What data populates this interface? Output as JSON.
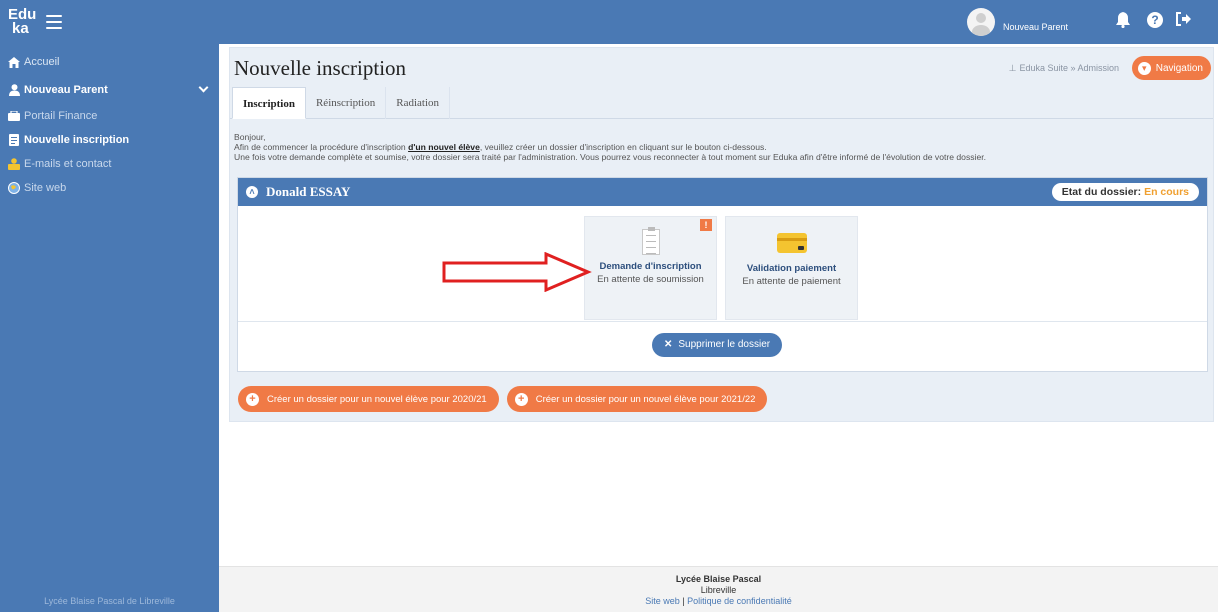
{
  "brand": {
    "logo_line1": "Edu",
    "logo_line2": "ka"
  },
  "sidebar": {
    "items": [
      {
        "label": "Accueil",
        "icon": "home-icon"
      },
      {
        "label": "Nouveau Parent",
        "icon": "user-icon"
      },
      {
        "label": "Portail Finance",
        "icon": "finance-icon"
      },
      {
        "label": "Nouvelle inscription",
        "icon": "document-icon"
      },
      {
        "label": "E-mails et contact",
        "icon": "mail-icon"
      },
      {
        "label": "Site web",
        "icon": "globe-icon"
      }
    ],
    "footer": "Lycée Blaise Pascal de Libreville"
  },
  "topbar": {
    "user_name": "Nouveau Parent",
    "icons": [
      "bell-icon",
      "help-icon",
      "logout-icon"
    ]
  },
  "page": {
    "title": "Nouvelle inscription",
    "breadcrumb": "Eduka Suite » Admission",
    "nav_button": "Navigation"
  },
  "tabs": [
    "Inscription",
    "Réinscription",
    "Radiation"
  ],
  "intro": {
    "line1": "Bonjour,",
    "line2_a": "Afin de commencer la procédure d'inscription ",
    "line2_em": "d'un nouvel élève",
    "line2_b": ", veuillez créer un dossier d'inscription en cliquant sur le bouton ci-dessous.",
    "line3": "Une fois votre demande complète et soumise, votre dossier sera traité par l'administration. Vous pourrez vous reconnecter à tout moment sur Eduka afin d'être informé de l'évolution de votre dossier."
  },
  "dossier": {
    "name": "Donald ESSAY",
    "state_label": "Etat du dossier:",
    "state_value": "En cours",
    "cards": [
      {
        "title": "Demande d'inscription",
        "status": "En attente de soumission",
        "badge": "!"
      },
      {
        "title": "Validation paiement",
        "status": "En attente de paiement"
      }
    ],
    "delete_label": "Supprimer le dossier"
  },
  "create_buttons": [
    "Créer un dossier pour un nouvel élève pour 2020/21",
    "Créer un dossier pour un nouvel élève pour 2021/22"
  ],
  "footer": {
    "school": "Lycée Blaise Pascal",
    "city": "Libreville",
    "link1": "Site web",
    "sep": " | ",
    "link2": "Politique de confidentialité"
  },
  "colors": {
    "primary": "#4a79b4",
    "accent": "#f07a46",
    "state": "#f0a030",
    "annotation_arrow": "#e02020"
  }
}
